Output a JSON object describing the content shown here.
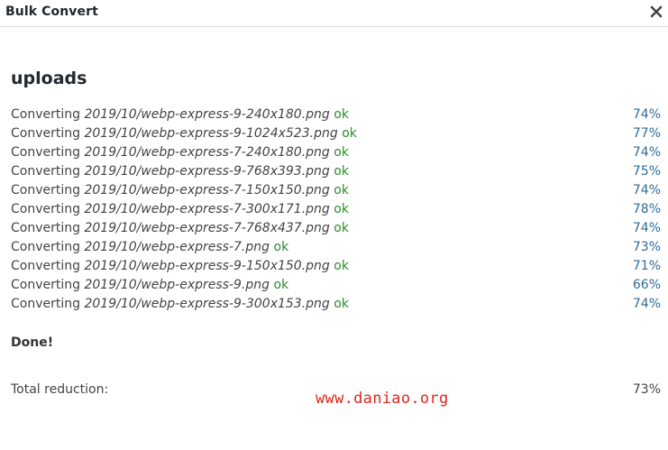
{
  "dialog": {
    "title": "Bulk Convert",
    "close_icon": "close-icon"
  },
  "section": {
    "heading": "uploads"
  },
  "rows": [
    {
      "prefix": "Converting",
      "file": "2019/10/webp-express-9-240x180.png",
      "status": "ok",
      "reduction": "74%"
    },
    {
      "prefix": "Converting",
      "file": "2019/10/webp-express-9-1024x523.png",
      "status": "ok",
      "reduction": "77%"
    },
    {
      "prefix": "Converting",
      "file": "2019/10/webp-express-7-240x180.png",
      "status": "ok",
      "reduction": "74%"
    },
    {
      "prefix": "Converting",
      "file": "2019/10/webp-express-9-768x393.png",
      "status": "ok",
      "reduction": "75%"
    },
    {
      "prefix": "Converting",
      "file": "2019/10/webp-express-7-150x150.png",
      "status": "ok",
      "reduction": "74%"
    },
    {
      "prefix": "Converting",
      "file": "2019/10/webp-express-7-300x171.png",
      "status": "ok",
      "reduction": "78%"
    },
    {
      "prefix": "Converting",
      "file": "2019/10/webp-express-7-768x437.png",
      "status": "ok",
      "reduction": "74%"
    },
    {
      "prefix": "Converting",
      "file": "2019/10/webp-express-7.png",
      "status": "ok",
      "reduction": "73%"
    },
    {
      "prefix": "Converting",
      "file": "2019/10/webp-express-9-150x150.png",
      "status": "ok",
      "reduction": "71%"
    },
    {
      "prefix": "Converting",
      "file": "2019/10/webp-express-9.png",
      "status": "ok",
      "reduction": "66%"
    },
    {
      "prefix": "Converting",
      "file": "2019/10/webp-express-9-300x153.png",
      "status": "ok",
      "reduction": "74%"
    }
  ],
  "summary": {
    "done": "Done!",
    "total_label": "Total reduction:",
    "total_value": "73%"
  },
  "watermark": {
    "text": "www.daniao.org"
  },
  "colors": {
    "ok": "#2e8b2e",
    "percent": "#2f6b9a",
    "watermark": "#e0251b"
  }
}
